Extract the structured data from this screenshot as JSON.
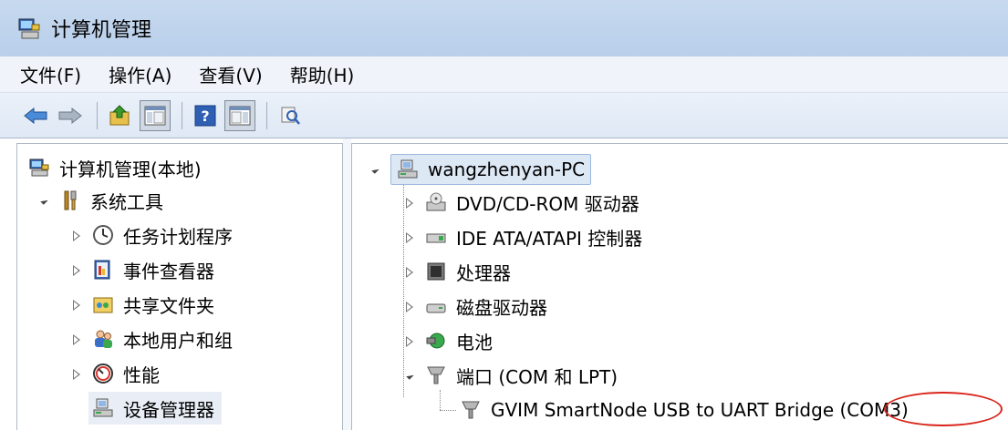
{
  "window": {
    "title": "计算机管理"
  },
  "menu": [
    "文件(F)",
    "操作(A)",
    "查看(V)",
    "帮助(H)"
  ],
  "toolbar": {
    "buttons": [
      "back-icon",
      "forward-icon",
      "up-folder-icon",
      "show-hide-tree-icon",
      "help-icon",
      "show-hide-action-pane-icon",
      "properties-icon"
    ]
  },
  "left_tree": {
    "root": "计算机管理(本地)",
    "system_tools": "系统工具",
    "items": [
      "任务计划程序",
      "事件查看器",
      "共享文件夹",
      "本地用户和组",
      "性能",
      "设备管理器"
    ]
  },
  "right_tree": {
    "root": "wangzhenyan-PC",
    "items": [
      "DVD/CD-ROM 驱动器",
      "IDE ATA/ATAPI 控制器",
      "处理器",
      "磁盘驱动器",
      "电池",
      "端口 (COM 和 LPT)"
    ],
    "port_child": "GVIM SmartNode USB to UART Bridge (COM3)"
  },
  "colors": {
    "title_bar": "#c6d9ef",
    "selection": "#dde8f5",
    "annotation_red": "#d9261c"
  }
}
